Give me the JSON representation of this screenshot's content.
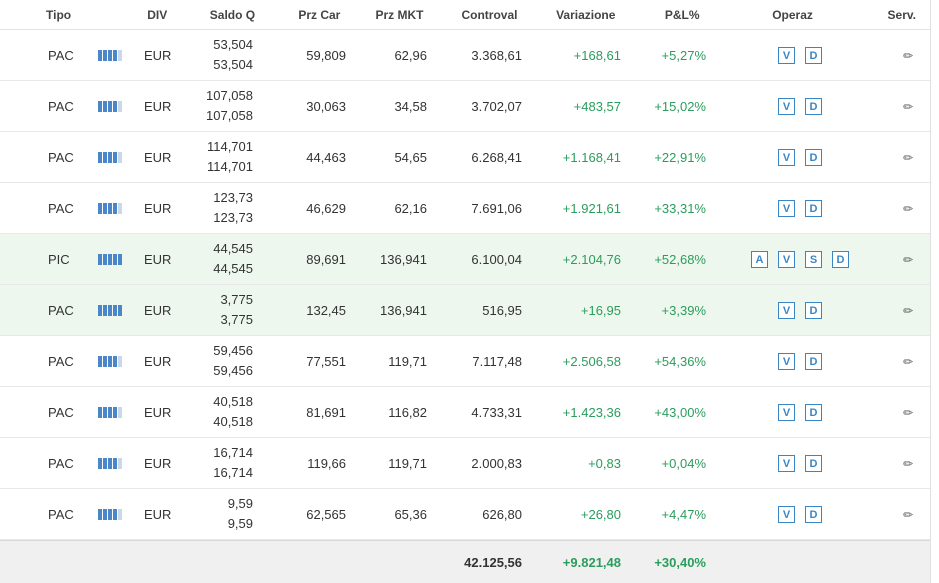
{
  "columns": {
    "tipo": "Tipo",
    "div": "DIV",
    "saldo": "Saldo Q",
    "prz_car": "Prz Car",
    "prz_mkt": "Prz MKT",
    "controval": "Controval",
    "variazione": "Variazione",
    "pl": "P&L%",
    "operaz": "Operaz",
    "serv": "Serv."
  },
  "rows": [
    {
      "tipo": "PAC",
      "div": "EUR",
      "qty1": "53,504",
      "qty2": "53,504",
      "prz_car": "59,809",
      "prz_mkt": "62,96",
      "controval": "3.368,61",
      "variazione": "+168,61",
      "pl": "+5,27%",
      "ops": [
        "V",
        "D"
      ],
      "bars": 0.85,
      "highlight": false
    },
    {
      "tipo": "PAC",
      "div": "EUR",
      "qty1": "107,058",
      "qty2": "107,058",
      "prz_car": "30,063",
      "prz_mkt": "34,58",
      "controval": "3.702,07",
      "variazione": "+483,57",
      "pl": "+15,02%",
      "ops": [
        "V",
        "D"
      ],
      "bars": 0.85,
      "highlight": false
    },
    {
      "tipo": "PAC",
      "div": "EUR",
      "qty1": "114,701",
      "qty2": "114,701",
      "prz_car": "44,463",
      "prz_mkt": "54,65",
      "controval": "6.268,41",
      "variazione": "+1.168,41",
      "pl": "+22,91%",
      "ops": [
        "V",
        "D"
      ],
      "bars": 0.85,
      "highlight": false
    },
    {
      "tipo": "PAC",
      "div": "EUR",
      "qty1": "123,73",
      "qty2": "123,73",
      "prz_car": "46,629",
      "prz_mkt": "62,16",
      "controval": "7.691,06",
      "variazione": "+1.921,61",
      "pl": "+33,31%",
      "ops": [
        "V",
        "D"
      ],
      "bars": 0.85,
      "highlight": false
    },
    {
      "tipo": "PIC",
      "div": "EUR",
      "qty1": "44,545",
      "qty2": "44,545",
      "prz_car": "89,691",
      "prz_mkt": "136,941",
      "controval": "6.100,04",
      "variazione": "+2.104,76",
      "pl": "+52,68%",
      "ops": [
        "A",
        "V",
        "S",
        "D"
      ],
      "bars": 1.0,
      "highlight": true
    },
    {
      "tipo": "PAC",
      "div": "EUR",
      "qty1": "3,775",
      "qty2": "3,775",
      "prz_car": "132,45",
      "prz_mkt": "136,941",
      "controval": "516,95",
      "variazione": "+16,95",
      "pl": "+3,39%",
      "ops": [
        "V",
        "D"
      ],
      "bars": 1.0,
      "highlight": true
    },
    {
      "tipo": "PAC",
      "div": "EUR",
      "qty1": "59,456",
      "qty2": "59,456",
      "prz_car": "77,551",
      "prz_mkt": "119,71",
      "controval": "7.117,48",
      "variazione": "+2.506,58",
      "pl": "+54,36%",
      "ops": [
        "V",
        "D"
      ],
      "bars": 0.85,
      "highlight": false
    },
    {
      "tipo": "PAC",
      "div": "EUR",
      "qty1": "40,518",
      "qty2": "40,518",
      "prz_car": "81,691",
      "prz_mkt": "116,82",
      "controval": "4.733,31",
      "variazione": "+1.423,36",
      "pl": "+43,00%",
      "ops": [
        "V",
        "D"
      ],
      "bars": 0.85,
      "highlight": false
    },
    {
      "tipo": "PAC",
      "div": "EUR",
      "qty1": "16,714",
      "qty2": "16,714",
      "prz_car": "119,66",
      "prz_mkt": "119,71",
      "controval": "2.000,83",
      "variazione": "+0,83",
      "pl": "+0,04%",
      "ops": [
        "V",
        "D"
      ],
      "bars": 0.85,
      "highlight": false
    },
    {
      "tipo": "PAC",
      "div": "EUR",
      "qty1": "9,59",
      "qty2": "9,59",
      "prz_car": "62,565",
      "prz_mkt": "65,36",
      "controval": "626,80",
      "variazione": "+26,80",
      "pl": "+4,47%",
      "ops": [
        "V",
        "D"
      ],
      "bars": 0.85,
      "highlight": false
    }
  ],
  "totals": {
    "controval": "42.125,56",
    "variazione": "+9.821,48",
    "pl": "+30,40%"
  },
  "icons": {
    "signal": "signal-bars-icon",
    "edit": "pencil-icon"
  },
  "colors": {
    "positive": "#2a9d5c",
    "action": "#3a86c5",
    "highlight_row": "#eef7ee",
    "bars": "#4a86c8"
  }
}
